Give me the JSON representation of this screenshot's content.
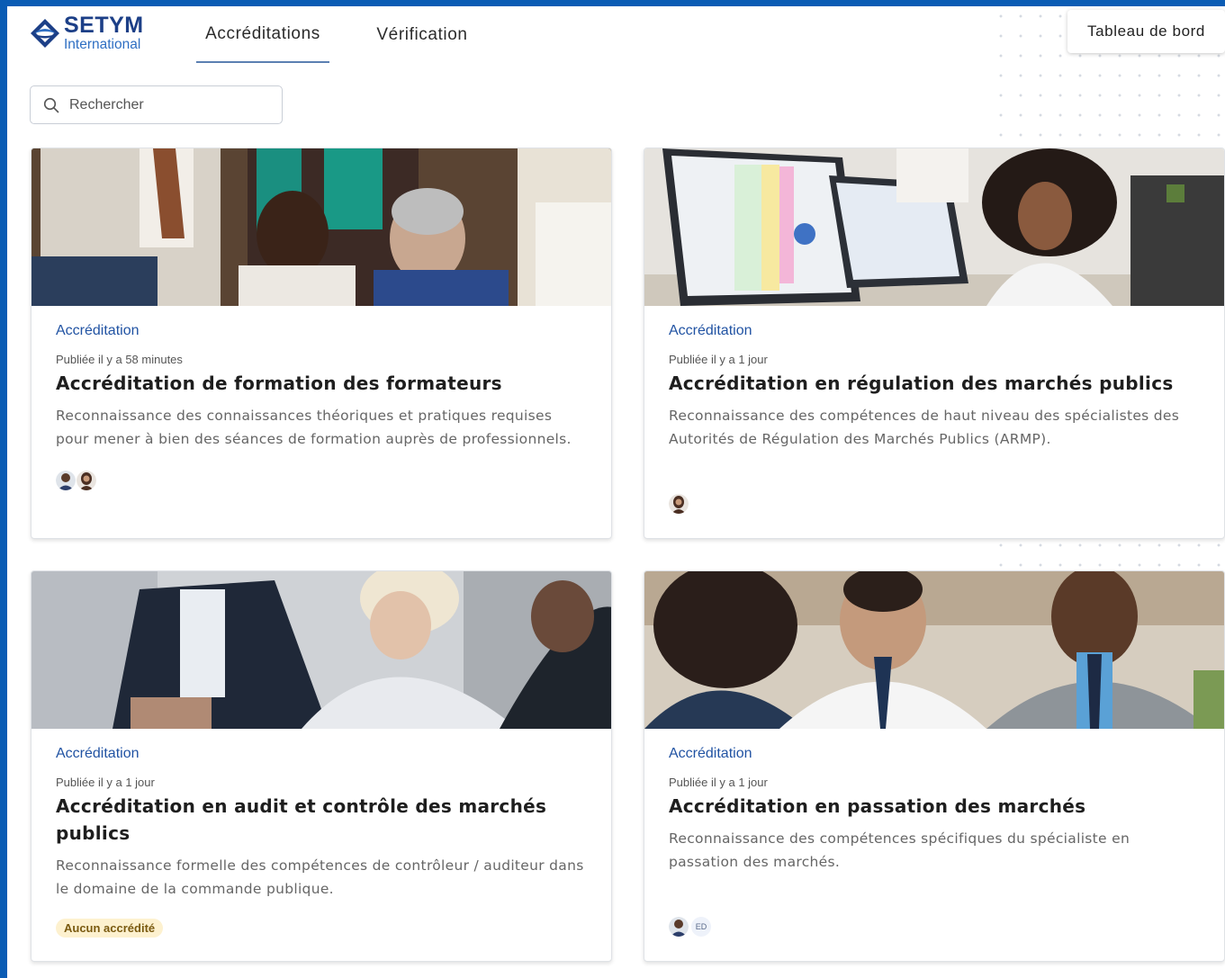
{
  "header": {
    "logo_name": "SETYM",
    "logo_sub": "International",
    "tabs": [
      {
        "label": "Accréditations",
        "active": true
      },
      {
        "label": "Vérification",
        "active": false
      }
    ],
    "dashboard_label": "Tableau de bord"
  },
  "search": {
    "placeholder": "Rechercher",
    "value": ""
  },
  "cards": [
    {
      "category": "Accréditation",
      "published": "Publiée il y a 58 minutes",
      "title": "Accréditation de formation des formateurs",
      "description": "Reconnaissance des connaissances théoriques et pratiques requises pour mener à bien des séances de formation auprès de professionnels.",
      "image": "meeting-group-photo",
      "avatars": [
        "man-avatar",
        "woman-avatar"
      ]
    },
    {
      "category": "Accréditation",
      "published": "Publiée il y a 1 jour",
      "title": "Accréditation en régulation des marchés publics",
      "description": "Reconnaissance des compétences de haut niveau des spécialistes des Autorités de Régulation des Marchés Publics (ARMP).",
      "image": "office-monitors-photo",
      "avatars": [
        "woman-avatar"
      ]
    },
    {
      "category": "Accréditation",
      "published": "Publiée il y a 1 jour",
      "title": "Accréditation en audit et contrôle des marchés publics",
      "description": "Reconnaissance formelle des compétences de contrôleur / auditeur dans le domaine de la commande publique.",
      "image": "business-discussion-photo",
      "badge": "Aucun accrédité"
    },
    {
      "category": "Accréditation",
      "published": "Publiée il y a 1 jour",
      "title": "Accréditation en passation des marchés",
      "description": "Reconnaissance des compétences spécifiques du spécialiste en passation des marchés.",
      "image": "smiling-team-photo",
      "avatars": [
        "man-avatar"
      ],
      "initials": "ED"
    }
  ],
  "colors": {
    "frame": "#0a5cb4",
    "accent": "#2153a3",
    "badge_bg": "#fdf1cf"
  }
}
